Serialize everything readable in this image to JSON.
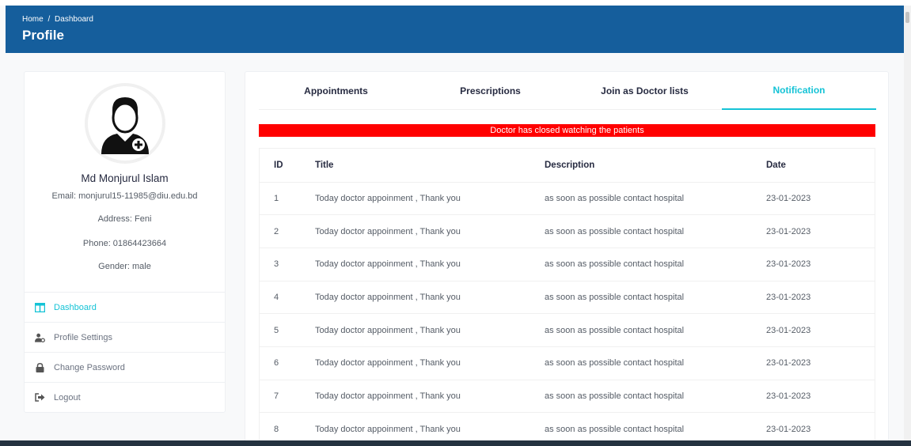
{
  "header": {
    "breadcrumb": [
      "Home",
      "/",
      "Dashboard"
    ],
    "title": "Profile",
    "bg_color": "#155e9c"
  },
  "profile": {
    "name": "Md Monjurul Islam",
    "email": "Email: monjurul15-11985@diu.edu.bd",
    "address": "Address: Feni",
    "phone": "Phone: 01864423664",
    "gender": "Gender: male",
    "avatar_icon": "doctor-avatar-icon"
  },
  "sidebar": {
    "items": [
      {
        "label": "Dashboard",
        "icon": "dashboard-icon",
        "active": true
      },
      {
        "label": "Profile Settings",
        "icon": "user-settings-icon",
        "active": false
      },
      {
        "label": "Change Password",
        "icon": "lock-icon",
        "active": false
      },
      {
        "label": "Logout",
        "icon": "logout-icon",
        "active": false
      }
    ]
  },
  "tabs": [
    {
      "label": "Appointments",
      "active": false
    },
    {
      "label": "Prescriptions",
      "active": false
    },
    {
      "label": "Join as Doctor lists",
      "active": false
    },
    {
      "label": "Notification",
      "active": true
    }
  ],
  "alert": {
    "text": "Doctor has closed watching the patients",
    "color": "#ff0000"
  },
  "table": {
    "columns": [
      "ID",
      "Title",
      "Description",
      "Date"
    ],
    "rows": [
      [
        "1",
        "Today doctor appoinment , Thank you",
        "as soon as possible contact hospital",
        "23-01-2023"
      ],
      [
        "2",
        "Today doctor appoinment , Thank you",
        "as soon as possible contact hospital",
        "23-01-2023"
      ],
      [
        "3",
        "Today doctor appoinment , Thank you",
        "as soon as possible contact hospital",
        "23-01-2023"
      ],
      [
        "4",
        "Today doctor appoinment , Thank you",
        "as soon as possible contact hospital",
        "23-01-2023"
      ],
      [
        "5",
        "Today doctor appoinment , Thank you",
        "as soon as possible contact hospital",
        "23-01-2023"
      ],
      [
        "6",
        "Today doctor appoinment , Thank you",
        "as soon as possible contact hospital",
        "23-01-2023"
      ],
      [
        "7",
        "Today doctor appoinment , Thank you",
        "as soon as possible contact hospital",
        "23-01-2023"
      ],
      [
        "8",
        "Today doctor appoinment , Thank you",
        "as soon as possible contact hospital",
        "23-01-2023"
      ]
    ]
  },
  "colors": {
    "accent": "#15c3d6",
    "text": "#272b41"
  }
}
